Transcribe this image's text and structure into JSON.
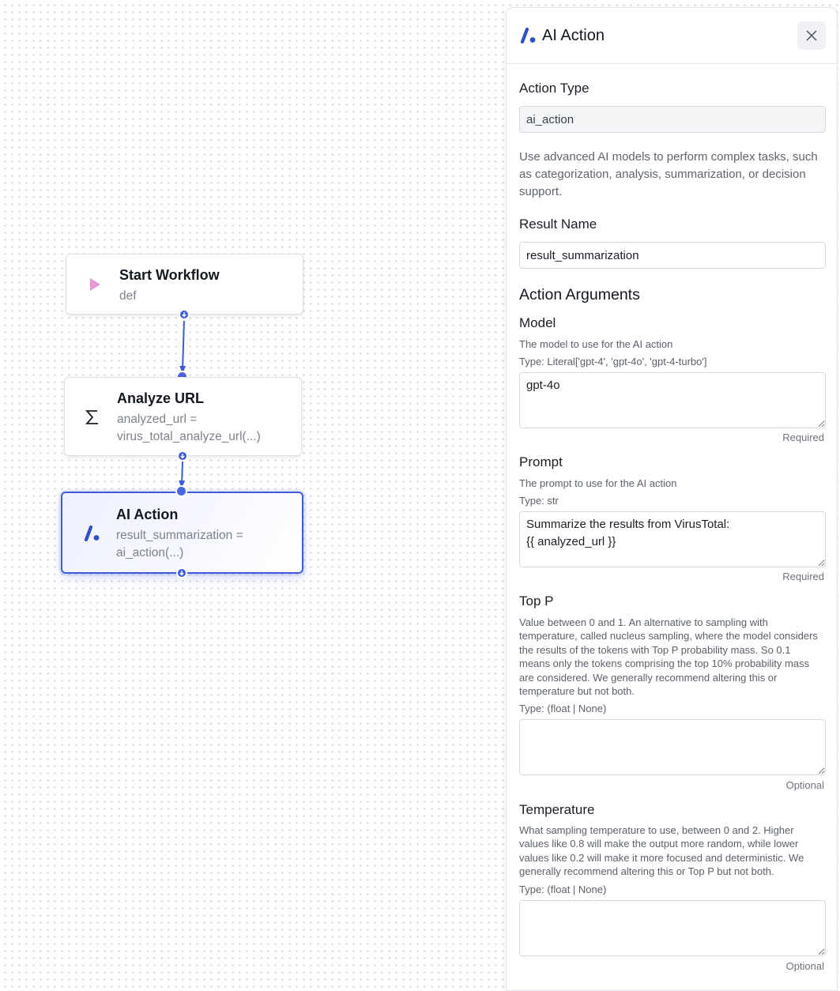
{
  "nodes": {
    "start": {
      "title": "Start Workflow",
      "subtitle": "def",
      "icon": "play-icon"
    },
    "analyze": {
      "title": "Analyze URL",
      "subtitle": "analyzed_url = virus_total_analyze_url(...)",
      "icon": "sigma-icon"
    },
    "ai": {
      "title": "AI Action",
      "subtitle": "result_summarization = ai_action(...)",
      "icon": "ai-logo-icon"
    }
  },
  "panel": {
    "title": "AI Action",
    "action_type_label": "Action Type",
    "action_type_value": "ai_action",
    "description": "Use advanced AI models to perform complex tasks, such as categorization, analysis, summarization, or decision support.",
    "result_name_label": "Result Name",
    "result_name_value": "result_summarization",
    "arguments_heading": "Action Arguments",
    "arguments": [
      {
        "name": "Model",
        "help": "The model to use for the AI action",
        "type": "Type: Literal['gpt-4', 'gpt-4o', 'gpt-4-turbo']",
        "value": "gpt-4o",
        "requirement": "Required"
      },
      {
        "name": "Prompt",
        "help": "The prompt to use for the AI action",
        "type": "Type: str",
        "value": "Summarize the results from VirusTotal:\n{{ analyzed_url }}",
        "requirement": "Required"
      },
      {
        "name": "Top P",
        "help": "Value between 0 and 1. An alternative to sampling with temperature, called nucleus sampling, where the model considers the results of the tokens with Top P probability mass. So 0.1 means only the tokens comprising the top 10% probability mass are considered. We generally recommend altering this or temperature but not both.",
        "type": "Type: (float | None)",
        "value": "",
        "requirement": "Optional"
      },
      {
        "name": "Temperature",
        "help": "What sampling temperature to use, between 0 and 2. Higher values like 0.8 will make the output more random, while lower values like 0.2 will make it more focused and deterministic. We generally recommend altering this or Top P but not both.",
        "type": "Type: (float | None)",
        "value": "",
        "requirement": "Optional"
      }
    ]
  },
  "colors": {
    "accent": "#3d5bd9",
    "play": "#e39ad4",
    "logo": "#2f4fc9"
  }
}
